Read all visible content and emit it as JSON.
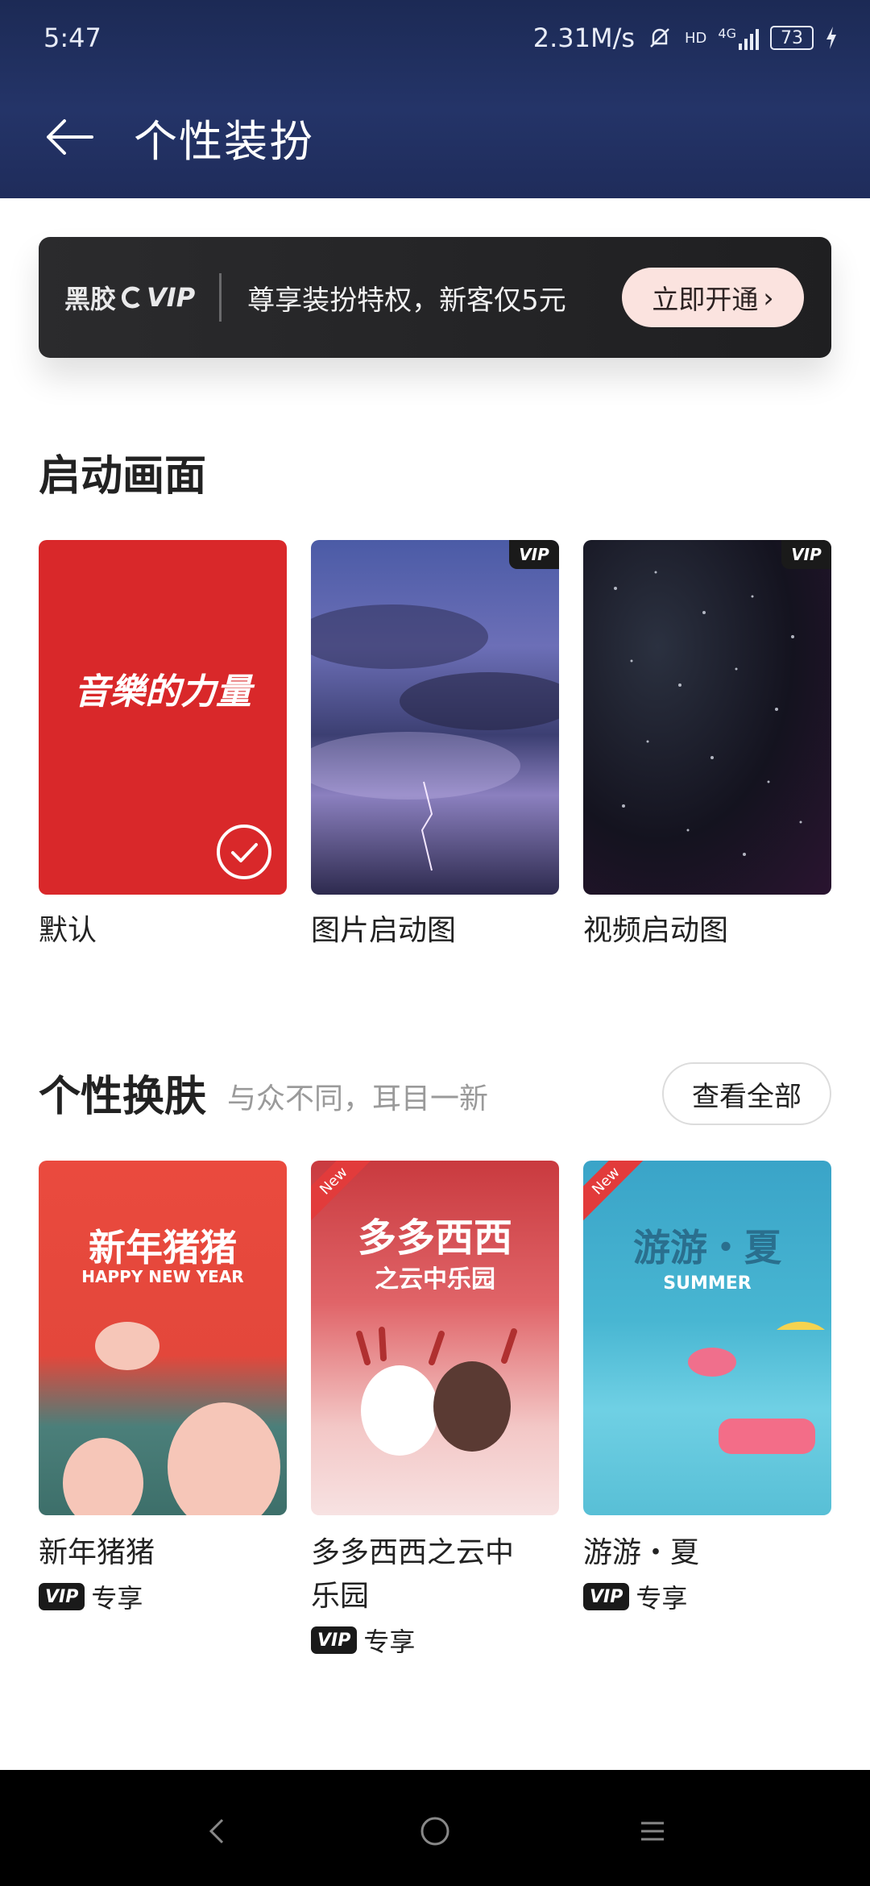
{
  "status": {
    "time": "5:47",
    "speed": "2.31M/s",
    "hd": "HD",
    "network": "4G",
    "battery": "73"
  },
  "header": {
    "title": "个性装扮"
  },
  "vip_banner": {
    "logo_brand": "黑胶",
    "logo_vip": "VIP",
    "text": "尊享装扮特权，新客仅5元",
    "button": "立即开通"
  },
  "startup": {
    "title": "启动画面",
    "items": [
      {
        "caption": "默认",
        "image_text": "音樂的力量",
        "selected": true,
        "vip": false
      },
      {
        "caption": "图片启动图",
        "vip": true,
        "badge": "VIP"
      },
      {
        "caption": "视频启动图",
        "vip": true,
        "badge": "VIP"
      }
    ]
  },
  "skins": {
    "title": "个性换肤",
    "subtitle": "与众不同，耳目一新",
    "see_all": "查看全部",
    "items": [
      {
        "caption": "新年猪猪",
        "art_title": "新年猪猪",
        "art_sub": "HAPPY NEW YEAR",
        "exclusive": "专享",
        "vip_tag": "VIP"
      },
      {
        "caption": "多多西西之云中乐园",
        "caption_line1": "多多西西之云中",
        "caption_line2": "乐园",
        "art_title": "多多西西",
        "art_sub": "之云中乐园",
        "new": "New",
        "exclusive": "专享",
        "vip_tag": "VIP"
      },
      {
        "caption": "游游・夏",
        "art_title": "游游・夏",
        "art_sub": "SUMMER",
        "new": "New",
        "exclusive": "专享",
        "vip_tag": "VIP"
      }
    ]
  },
  "colors": {
    "header": "#1f2c5b",
    "banner": "#2b2b2d",
    "button_pink": "#fbe3df",
    "default_red": "#db2b2b"
  }
}
